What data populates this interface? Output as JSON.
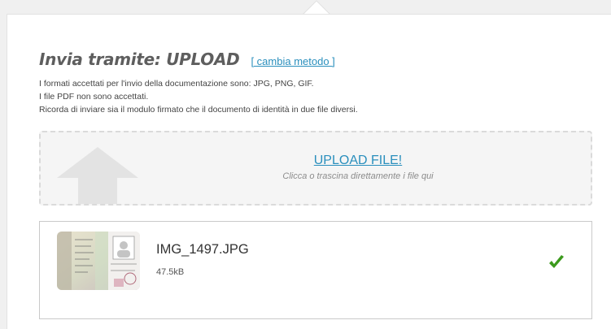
{
  "upload": {
    "title": "Invia tramite: UPLOAD",
    "change_method_link": "[ cambia metodo ]",
    "info_lines": [
      "I formati accettati per l'invio della documentazione sono: JPG, PNG, GIF.",
      "I file PDF non sono accettati.",
      "Ricorda di inviare sia il modulo firmato che il documento di identità in due file diversi."
    ],
    "dropzone": {
      "title": "UPLOAD FILE!",
      "subtitle": "Clicca o trascina direttamente i file qui",
      "icon": "upload-arrow-icon"
    },
    "file": {
      "name": "IMG_1497.JPG",
      "size": "47.5kB",
      "status_icon": "checkmark-icon",
      "status_color": "#3b9a1c"
    }
  },
  "colors": {
    "link": "#2a8fbd",
    "page_background": "#f0f0f0"
  }
}
